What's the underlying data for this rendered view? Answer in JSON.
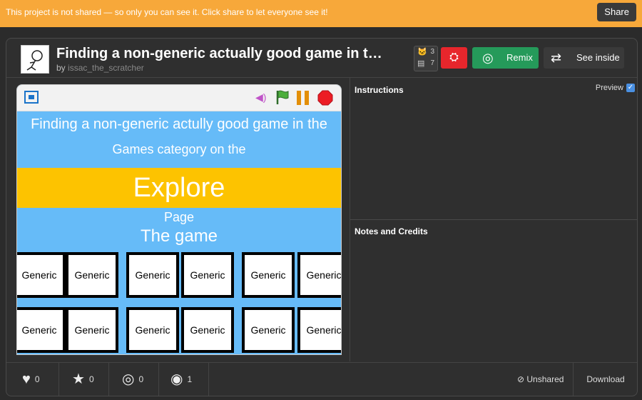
{
  "banner": {
    "text": "This project is not shared — so only you can see it. Click share to let everyone see it!",
    "share_label": "Share"
  },
  "project": {
    "title": "Finding a non-generic actually good game in t…",
    "by": "by",
    "author": "issac_the_scratcher"
  },
  "counts": {
    "sprites": "3",
    "scripts": "7"
  },
  "buttons": {
    "remix_label": "Remix",
    "see_inside_label": "See inside"
  },
  "stage": {
    "line1": "Finding a non-generic actully good game in the",
    "line2": "Games category on the",
    "explore": "Explore",
    "page": "Page",
    "the_game": "The game",
    "tiles_row1": [
      "Generic",
      "Generic",
      "Generic",
      "Generic",
      "Generic",
      "Generic"
    ],
    "tiles_row2": [
      "Generic",
      "Generic",
      "Generic",
      "Generic",
      "Generic",
      "Generic"
    ]
  },
  "instructions": {
    "title": "Instructions",
    "preview_label": "Preview"
  },
  "notes": {
    "title": "Notes and Credits"
  },
  "stats": {
    "loves": "0",
    "favorites": "0",
    "remixes": "0",
    "views": "1"
  },
  "footer": {
    "unshared": "Unshared",
    "download": "Download"
  },
  "colors": {
    "banner": "#f7a83a",
    "remix": "#259a5a",
    "red": "#e7262c",
    "stage_bg": "#66bbf8",
    "explore_bg": "#fdc300"
  }
}
